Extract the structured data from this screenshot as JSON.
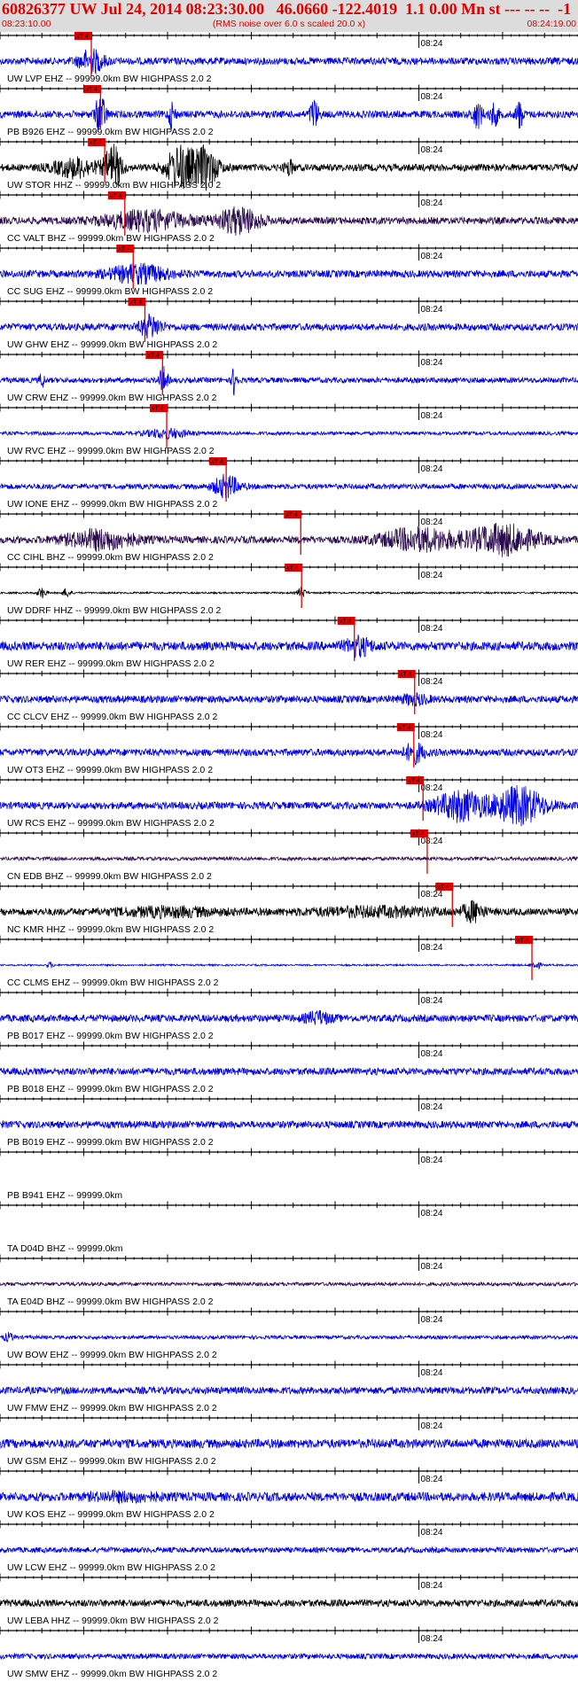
{
  "header": {
    "title": "60826377 UW Jul 24, 2014 08:23:30.00   46.0660 -122.4019  1.1 0.00 Mn st --- -- --  -1",
    "time_start": "08:23:10.00",
    "rms_note": "(RMS noise over 6.0 s scaled 20.0 x)",
    "time_end": "08:24:19.00"
  },
  "colors": {
    "header_bg": "#dcdcdc",
    "header_text": "#e00000",
    "pick": "#e00000",
    "axis": "#000000",
    "blue": "#0000e6",
    "black": "#000000",
    "purple": "#2b0a50"
  },
  "chart_data": {
    "type": "line",
    "title": "60826377 UW Jul 24, 2014 08:23:30.00",
    "x_range": [
      "08:23:10.00",
      "08:24:19.00"
    ],
    "xlim": [
      0,
      69
    ],
    "x_units": "seconds after 08:23:10",
    "tick_label": "08:24",
    "tick_label_time_s": 50,
    "pick_label": "xT 4",
    "grid": false,
    "series": [
      {
        "name": "UW LVP EHZ -- 99999.0km BW  HIGHPASS  2.0  2",
        "color": "blue",
        "pick_s": 10.9,
        "amp": 4,
        "bursts": [
          [
            10.9,
            1.5,
            12
          ]
        ]
      },
      {
        "name": "PB B926 EHZ -- 99999.0km BW  HIGHPASS  2.0  2",
        "color": "blue",
        "pick_s": 12.0,
        "amp": 4,
        "bursts": [
          [
            12.0,
            0.6,
            22
          ],
          [
            20.5,
            0.4,
            14
          ],
          [
            37.5,
            0.5,
            16
          ],
          [
            57,
            0.6,
            14
          ],
          [
            59,
            0.5,
            12
          ],
          [
            62,
            0.4,
            16
          ]
        ]
      },
      {
        "name": "UW STOR HHZ -- 99999.0km BW  HIGHPASS  2.0  2",
        "color": "black",
        "pick_s": 12.5,
        "amp": 4,
        "bursts": [
          [
            9.0,
            2.5,
            10
          ],
          [
            13.5,
            1.0,
            24
          ],
          [
            21.5,
            1.6,
            24
          ],
          [
            24.5,
            1.5,
            22
          ],
          [
            34.5,
            0.5,
            8
          ]
        ]
      },
      {
        "name": "CC VALT BHZ -- 99999.0km BW  HIGHPASS  2.0  2",
        "color": "purple",
        "pick_s": 14.9,
        "amp": 4,
        "bursts": [
          [
            17.5,
            5.0,
            10
          ],
          [
            28.5,
            2.5,
            14
          ]
        ]
      },
      {
        "name": "CC SUG EHZ -- 99999.0km BW  HIGHPASS  2.0  2",
        "color": "blue",
        "pick_s": 15.9,
        "amp": 4,
        "bursts": [
          [
            16.5,
            3.5,
            9
          ]
        ]
      },
      {
        "name": "UW GHW EHZ -- 99999.0km BW  HIGHPASS  2.0  2",
        "color": "blue",
        "pick_s": 17.3,
        "amp": 4,
        "bursts": [
          [
            18.0,
            1.2,
            12
          ]
        ]
      },
      {
        "name": "UW CRW EHZ -- 99999.0km BW  HIGHPASS  2.0  2",
        "color": "blue",
        "pick_s": 19.4,
        "amp": 3,
        "bursts": [
          [
            19.5,
            0.5,
            14
          ],
          [
            28.0,
            0.3,
            18
          ],
          [
            5.0,
            0.3,
            8
          ]
        ]
      },
      {
        "name": "UW RVC EHZ -- 99999.0km BW  HIGHPASS  2.0  2",
        "color": "blue",
        "pick_s": 19.9,
        "amp": 2,
        "bursts": [
          [
            20.0,
            2.5,
            5
          ]
        ]
      },
      {
        "name": "UW IONE EHZ -- 99999.0km BW  HIGHPASS  2.0  2",
        "color": "blue",
        "pick_s": 27.0,
        "amp": 3,
        "bursts": [
          [
            27.0,
            1.5,
            12
          ]
        ]
      },
      {
        "name": "CC CIHL BHZ -- 99999.0km BW  HIGHPASS  2.0  2",
        "color": "purple",
        "pick_s": 35.9,
        "amp": 4,
        "bursts": [
          [
            12.0,
            4.0,
            10
          ],
          [
            50.0,
            4.5,
            12
          ],
          [
            60.0,
            4.0,
            16
          ]
        ]
      },
      {
        "name": "UW DDRF HHZ -- 99999.0km BW  HIGHPASS  2.0  2",
        "color": "black",
        "pick_s": 36.0,
        "amp": 1,
        "bursts": [
          [
            5.0,
            0.5,
            6
          ],
          [
            8.0,
            0.5,
            5
          ],
          [
            36.0,
            0.5,
            6
          ]
        ]
      },
      {
        "name": "UW RER EHZ -- 99999.0km BW  HIGHPASS  2.0  2",
        "color": "blue",
        "pick_s": 42.3,
        "amp": 5,
        "bursts": [
          [
            42.8,
            1.5,
            9
          ]
        ]
      },
      {
        "name": "CC CLCV EHZ -- 99999.0km BW  HIGHPASS  2.0  2",
        "color": "blue",
        "pick_s": 49.5,
        "amp": 4,
        "bursts": [
          [
            49.5,
            1.5,
            5
          ]
        ]
      },
      {
        "name": "UW OT3 EHZ -- 99999.0km BW  HIGHPASS  2.0  2",
        "color": "blue",
        "pick_s": 49.4,
        "amp": 4,
        "bursts": [
          [
            49.5,
            1.2,
            10
          ]
        ]
      },
      {
        "name": "UW RCS EHZ -- 99999.0km BW  HIGHPASS  2.0  2",
        "color": "blue",
        "pick_s": 50.5,
        "amp": 4,
        "bursts": [
          [
            55.0,
            3.0,
            16
          ],
          [
            62.0,
            3.0,
            20
          ]
        ]
      },
      {
        "name": "CN EDB BHZ -- 99999.0km BW  HIGHPASS  2.0  2",
        "color": "purple",
        "pick_s": 51.0,
        "amp": 2,
        "bursts": []
      },
      {
        "name": "NC KMR HHZ -- 99999.0km BW  HIGHPASS  2.0  2",
        "color": "black",
        "pick_s": 54.0,
        "amp": 4,
        "bursts": [
          [
            56.5,
            1.2,
            10
          ],
          [
            20.0,
            6.0,
            4
          ],
          [
            45.0,
            8.0,
            4
          ]
        ]
      },
      {
        "name": "CC CLMS EHZ -- 99999.0km BW  HIGHPASS  2.0  2",
        "color": "blue",
        "pick_s": 63.5,
        "amp": 1,
        "bursts": [
          [
            64.0,
            0.5,
            5
          ],
          [
            6.0,
            0.4,
            3
          ]
        ]
      },
      {
        "name": "PB B017 EHZ -- 99999.0km BW  HIGHPASS  2.0  2",
        "color": "blue",
        "pick_s": null,
        "amp": 4,
        "bursts": [
          [
            38.0,
            1.5,
            6
          ]
        ]
      },
      {
        "name": "PB B018 EHZ -- 99999.0km BW  HIGHPASS  2.0  2",
        "color": "blue",
        "pick_s": null,
        "amp": 4,
        "bursts": []
      },
      {
        "name": "PB B019 EHZ -- 99999.0km BW  HIGHPASS  2.0  2",
        "color": "blue",
        "pick_s": null,
        "amp": 4,
        "bursts": []
      },
      {
        "name": "PB B941 EHZ -- 99999.0km",
        "color": "none",
        "pick_s": null,
        "amp": 0,
        "bursts": []
      },
      {
        "name": "TA D04D BHZ -- 99999.0km",
        "color": "none",
        "pick_s": null,
        "amp": 0,
        "bursts": []
      },
      {
        "name": "TA E04D BHZ -- 99999.0km BW  HIGHPASS  2.0  2",
        "color": "purple",
        "pick_s": null,
        "amp": 2,
        "bursts": []
      },
      {
        "name": "UW BOW EHZ -- 99999.0km BW  HIGHPASS  2.0  2",
        "color": "blue",
        "pick_s": null,
        "amp": 2,
        "bursts": [
          [
            1.0,
            0.6,
            4
          ]
        ]
      },
      {
        "name": "UW FMW EHZ -- 99999.0km BW  HIGHPASS  2.0  2",
        "color": "blue",
        "pick_s": null,
        "amp": 4,
        "bursts": []
      },
      {
        "name": "UW GSM EHZ -- 99999.0km BW  HIGHPASS  2.0  2",
        "color": "blue",
        "pick_s": null,
        "amp": 5,
        "bursts": []
      },
      {
        "name": "UW KOS EHZ -- 99999.0km BW  HIGHPASS  2.0  2",
        "color": "blue",
        "pick_s": null,
        "amp": 5,
        "bursts": [
          [
            15.0,
            4.0,
            3
          ]
        ]
      },
      {
        "name": "UW LCW EHZ -- 99999.0km BW  HIGHPASS  2.0  2",
        "color": "blue",
        "pick_s": null,
        "amp": 3,
        "bursts": []
      },
      {
        "name": "UW LEBA HHZ -- 99999.0km BW  HIGHPASS  2.0  2",
        "color": "black",
        "pick_s": null,
        "amp": 4,
        "bursts": []
      },
      {
        "name": "UW SMW EHZ -- 99999.0km BW  HIGHPASS  2.0  2",
        "color": "blue",
        "pick_s": null,
        "amp": 3,
        "bursts": []
      }
    ]
  }
}
